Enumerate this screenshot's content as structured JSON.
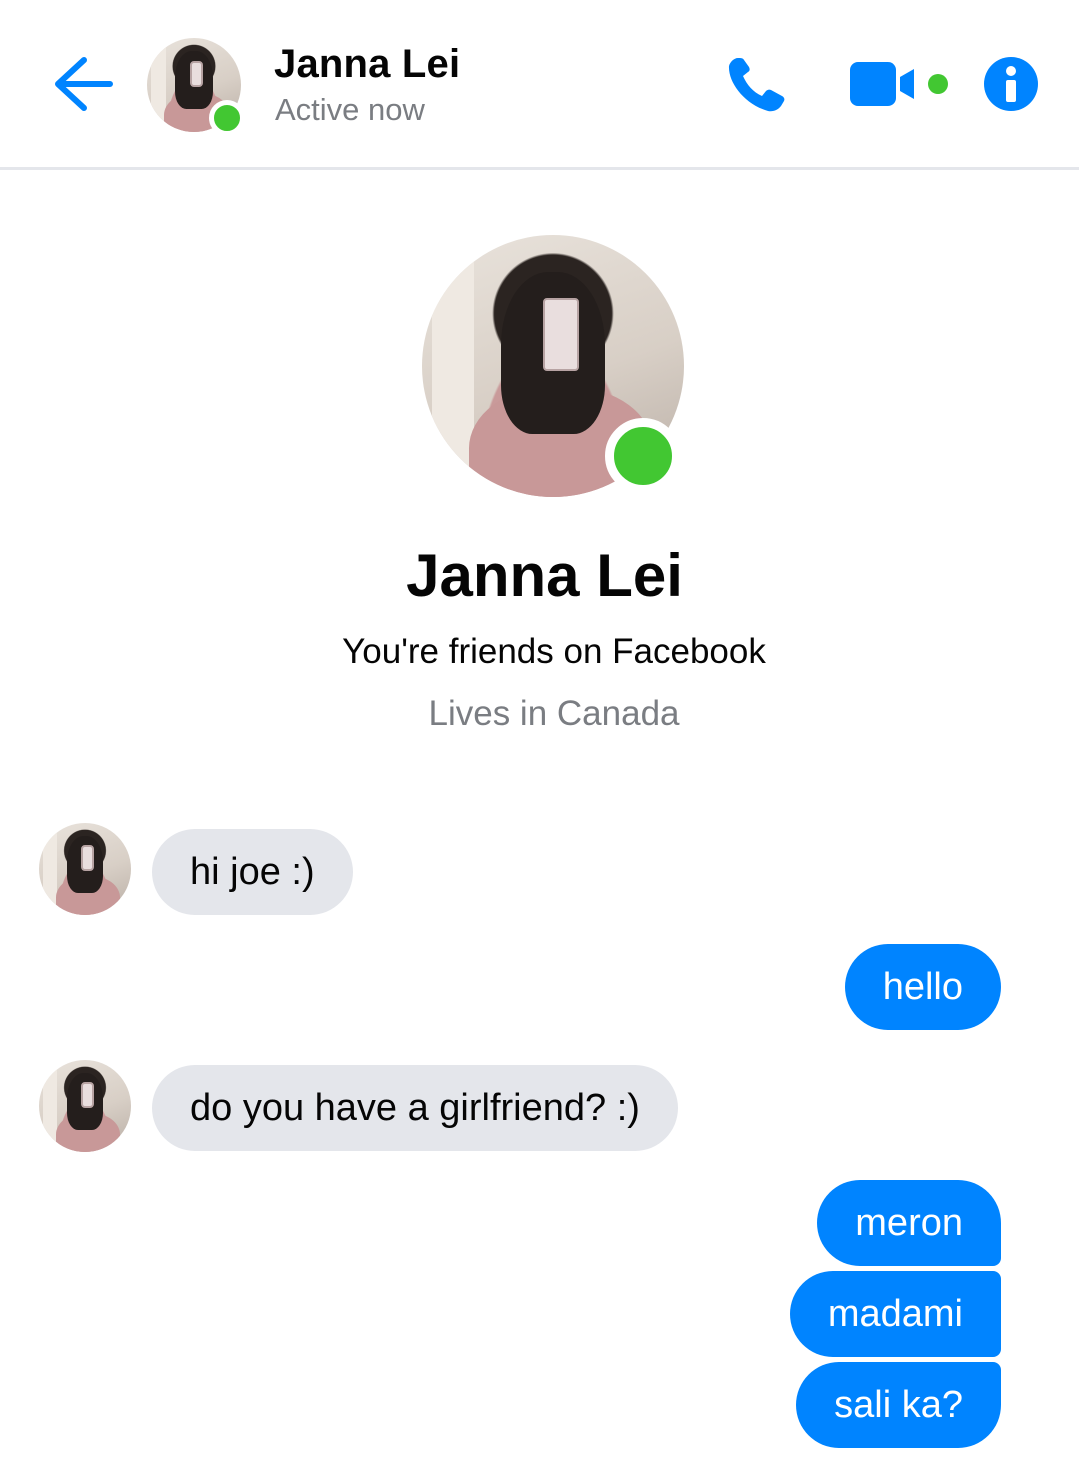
{
  "header": {
    "name": "Janna Lei",
    "status": "Active now"
  },
  "profile": {
    "name": "Janna Lei",
    "friends_text": "You're friends on Facebook",
    "location": "Lives in Canada"
  },
  "messages": [
    {
      "direction": "incoming",
      "text": "hi joe :)"
    },
    {
      "direction": "outgoing",
      "text": "hello"
    },
    {
      "direction": "incoming",
      "text": "do you have a girlfriend? :)"
    },
    {
      "direction": "outgoing",
      "text": "meron"
    },
    {
      "direction": "outgoing",
      "text": "madami"
    },
    {
      "direction": "outgoing",
      "text": "sali ka?"
    }
  ],
  "icons": {
    "back": "back-arrow-icon",
    "call": "phone-icon",
    "video": "video-camera-icon",
    "info": "info-icon"
  },
  "colors": {
    "accent": "#0084ff",
    "online": "#42c732",
    "incoming_bubble": "#e4e6eb",
    "secondary_text": "#7a7d82"
  }
}
